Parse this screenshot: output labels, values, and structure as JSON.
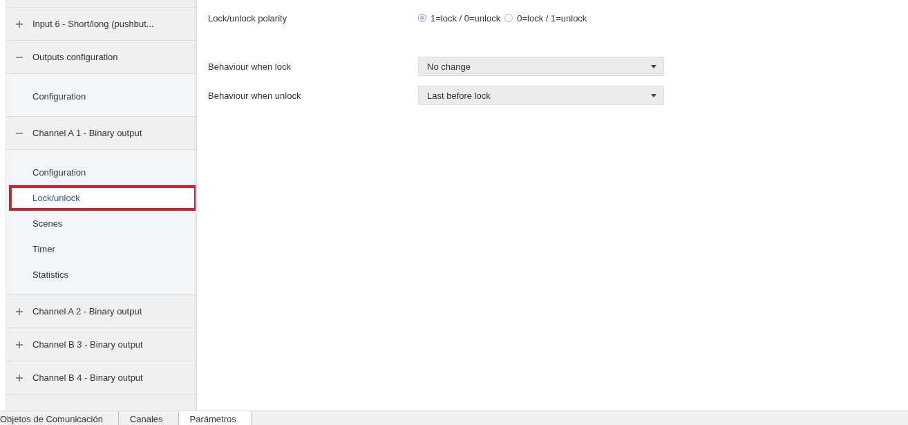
{
  "sidebar": {
    "items": [
      {
        "label": "Input 6 - Short/long (pushbut...",
        "expanded": false
      },
      {
        "label": "Outputs configuration",
        "expanded": true,
        "children": [
          {
            "label": "Configuration",
            "selected": false
          }
        ]
      },
      {
        "label": "Channel A 1 - Binary output",
        "expanded": true,
        "children": [
          {
            "label": "Configuration",
            "selected": false
          },
          {
            "label": "Lock/unlock",
            "selected": true
          },
          {
            "label": "Scenes",
            "selected": false
          },
          {
            "label": "Timer",
            "selected": false
          },
          {
            "label": "Statistics",
            "selected": false
          }
        ]
      },
      {
        "label": "Channel A 2 - Binary output",
        "expanded": false
      },
      {
        "label": "Channel B 3 - Binary output",
        "expanded": false
      },
      {
        "label": "Channel B 4 - Binary output",
        "expanded": false
      }
    ]
  },
  "parameters": [
    {
      "kind": "radio",
      "label": "Lock/unlock polarity",
      "options": [
        {
          "label": "1=lock / 0=unlock",
          "selected": true
        },
        {
          "label": "0=lock / 1=unlock",
          "selected": false
        }
      ]
    },
    {
      "kind": "select",
      "label": "Behaviour when lock",
      "value": "No change"
    },
    {
      "kind": "select",
      "label": "Behaviour when unlock",
      "value": "Last before lock"
    }
  ],
  "tabs": [
    {
      "label": "Objetos de Comunicación",
      "selected": false
    },
    {
      "label": "Canales",
      "selected": false
    },
    {
      "label": "Parámetros",
      "selected": true
    }
  ]
}
